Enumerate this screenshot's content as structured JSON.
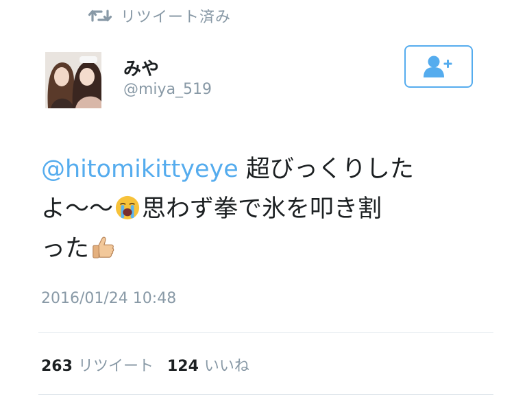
{
  "retweet_header": {
    "icon": "retweet-icon",
    "label": "リツイート済み"
  },
  "author": {
    "name": "みや",
    "handle": "@miya_519",
    "avatar": "avatar-photo"
  },
  "follow_button": {
    "icon": "add-user-icon",
    "accent": "#55acee"
  },
  "tweet": {
    "mention": "@hitomikittyeye",
    "line1_text": " 超びっくりした",
    "line2_a": "よ〜〜",
    "emoji_1": "loudly-crying-face-icon",
    "line2_b": "思わず拳で氷を叩き割",
    "line3_a": "った",
    "emoji_2": "thumbs-up-icon"
  },
  "timestamp": "2016/01/24 10:48",
  "stats": {
    "retweet_count": "263",
    "retweet_label": "リツイート",
    "like_count": "124",
    "like_label": "いいね"
  },
  "colors": {
    "link": "#55acee",
    "muted": "#8899a6",
    "text": "#1c2022",
    "divider": "#e1e8ed"
  }
}
